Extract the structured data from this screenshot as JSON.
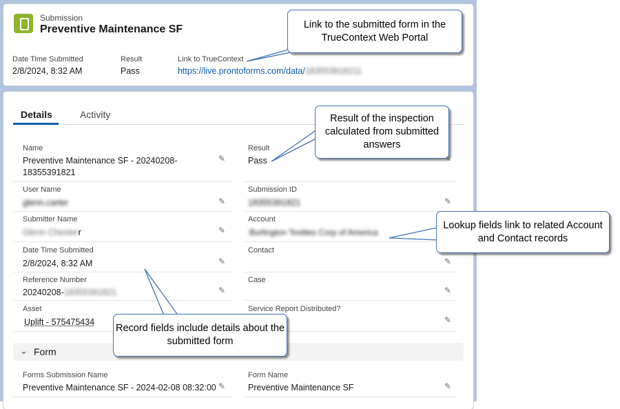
{
  "header": {
    "object_label": "Submission",
    "title": "Preventive Maintenance SF",
    "highlights": [
      {
        "label": "Date Time Submitted",
        "value": "2/8/2024, 8:32 AM"
      },
      {
        "label": "Result",
        "value": "Pass"
      },
      {
        "label": "Link to TrueContext",
        "value": "https://live.prontoforms.com/data/",
        "redacted": "183553918211"
      }
    ]
  },
  "tabs": [
    {
      "label": "Details",
      "active": true
    },
    {
      "label": "Activity",
      "active": false
    }
  ],
  "fields_left": [
    {
      "label": "Name",
      "value": "Preventive Maintenance SF - 20240208-",
      "value2": "18355391821"
    },
    {
      "label": "User Name",
      "value": "glenn.carter"
    },
    {
      "label": "Submitter Name",
      "value": "Glenn Chester",
      "suffix": "r"
    },
    {
      "label": "Date Time Submitted",
      "value": "2/8/2024, 8:32 AM"
    },
    {
      "label": "Reference Number",
      "value": "20240208-",
      "redacted": "18355391821"
    },
    {
      "label": "Asset",
      "value": "Uplift - 575475434"
    }
  ],
  "fields_right": [
    {
      "label": "Result",
      "value": "Pass"
    },
    {
      "label": "Submission ID",
      "value": "18355391821"
    },
    {
      "label": "Account",
      "value": "Burlington Textiles Corp of America"
    },
    {
      "label": "Contact",
      "value": ""
    },
    {
      "label": "Case",
      "value": ""
    },
    {
      "label": "Service Report Distributed?",
      "value": ""
    }
  ],
  "form_section": {
    "title": "Form",
    "fields": [
      {
        "label": "Forms Submission Name",
        "value": "Preventive Maintenance SF - 2024-02-08 08:32:00"
      },
      {
        "label": "Form Name",
        "value": "Preventive Maintenance SF"
      }
    ]
  },
  "callouts": {
    "link": "Link to the submitted form in the TrueContext Web Portal",
    "result": "Result of the inspection calculated from submitted answers",
    "lookup": "Lookup fields link to related Account and Contact records",
    "record": "Record fields include details about the submitted form"
  },
  "colors": {
    "accent": "#0b5cab",
    "icon_bg": "#8bb52c",
    "callout_border": "#3f6fb5",
    "page_bg": "#b0c4df"
  },
  "icons": {
    "app": "document-icon",
    "edit": "pencil-icon",
    "section": "chevron-down-icon"
  }
}
